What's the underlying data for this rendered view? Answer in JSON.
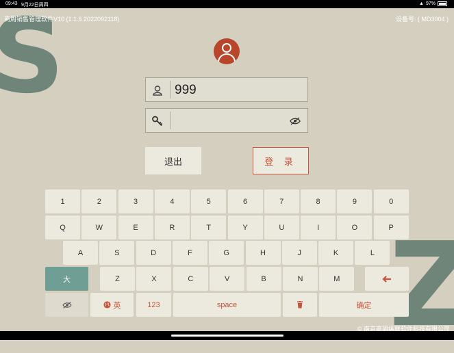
{
  "status_bar": {
    "time": "09:43",
    "date": "9月22日周四",
    "battery": "97%"
  },
  "decor": {
    "letter_left": "S",
    "letter_right": "Z",
    "color": "#6f857a"
  },
  "header": {
    "app_title": "商周销售管理软件V10 (1.1.6 2022092118)",
    "device_id": "设备号: ( MD3004 )"
  },
  "login": {
    "username_value": "999",
    "password_value": "",
    "exit_label": "退出",
    "login_label": "登 录",
    "accent_color": "#c5543a"
  },
  "keyboard": {
    "row_numbers": [
      "1",
      "2",
      "3",
      "4",
      "5",
      "6",
      "7",
      "8",
      "9",
      "0"
    ],
    "row_q": [
      "Q",
      "W",
      "E",
      "R",
      "T",
      "Y",
      "U",
      "I",
      "O",
      "P"
    ],
    "row_a": [
      "A",
      "S",
      "D",
      "F",
      "G",
      "H",
      "J",
      "K",
      "L"
    ],
    "row_z": [
      "Z",
      "X",
      "C",
      "V",
      "B",
      "N",
      "M"
    ],
    "shift_label": "大",
    "lang_label": "英",
    "num_label": "123",
    "space_label": "space",
    "confirm_label": "确定",
    "shift_color": "#6f9e95"
  },
  "footer": {
    "copyright": "© 南京商周纵联软件科技有限公司"
  },
  "icons": [
    "user-avatar-icon",
    "user-icon",
    "key-icon",
    "eye-off-icon",
    "backspace-arrow-icon",
    "globe-icon",
    "trash-icon"
  ]
}
